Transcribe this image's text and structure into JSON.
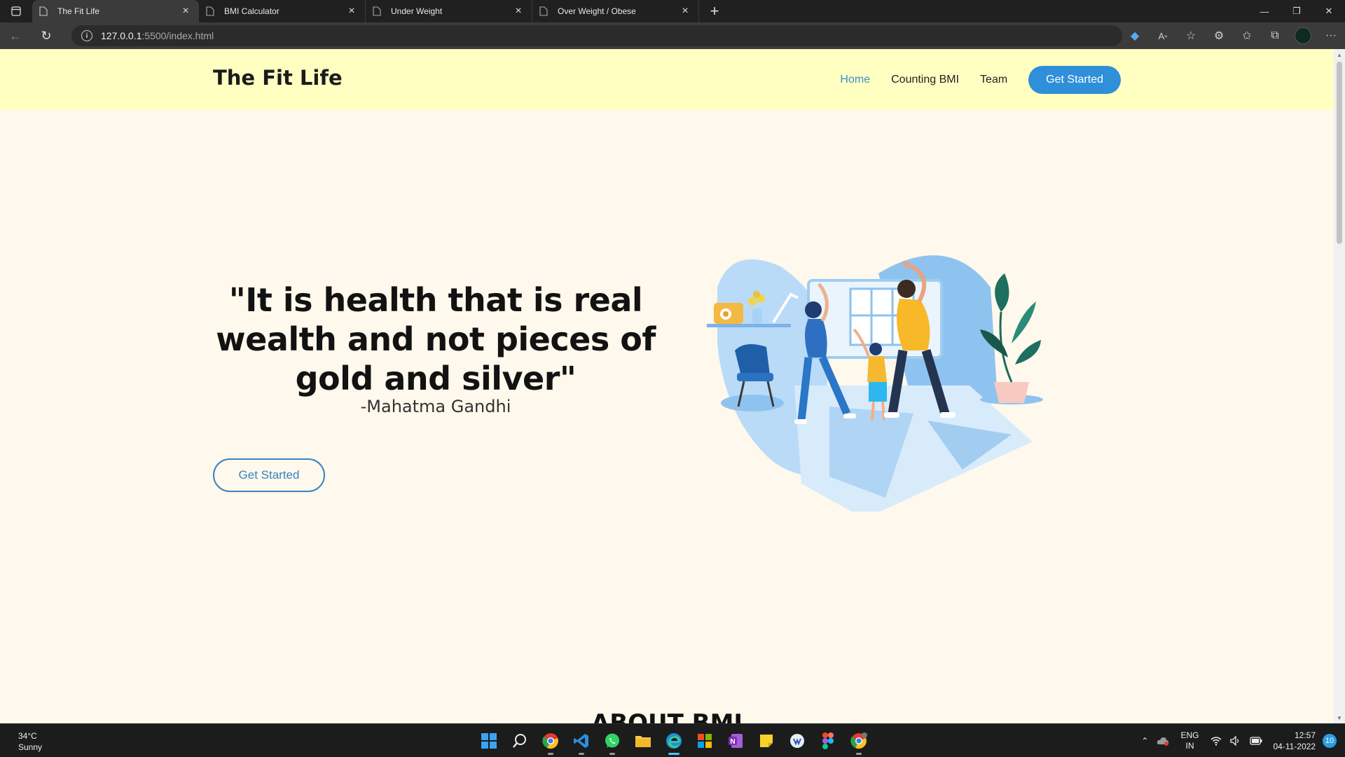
{
  "browser": {
    "tabs": [
      {
        "title": "The Fit Life",
        "active": true
      },
      {
        "title": "BMI Calculator",
        "active": false
      },
      {
        "title": "Under Weight",
        "active": false
      },
      {
        "title": "Over Weight / Obese",
        "active": false
      }
    ],
    "url_host": "127.0.0.1",
    "url_path": ":5500/index.html"
  },
  "site": {
    "brand": "The Fit Life",
    "nav": {
      "home": "Home",
      "counting_bmi": "Counting BMI",
      "team": "Team",
      "get_started": "Get Started"
    },
    "hero": {
      "quote": "\"It is health that is real wealth and not pieces of gold and silver\"",
      "author": "-Mahatma Gandhi",
      "button": "Get Started"
    },
    "next_section_heading": "ABOUT BMI"
  },
  "colors": {
    "header_bg": "#ffffc2",
    "page_bg": "#fff8ec",
    "accent": "#2f8fd8"
  },
  "taskbar": {
    "weather_temp": "34°C",
    "weather_desc": "Sunny",
    "lang_line1": "ENG",
    "lang_line2": "IN",
    "time": "12:57",
    "date": "04-11-2022",
    "notification_count": "10",
    "apps": [
      "start-icon",
      "search-icon",
      "chrome-icon",
      "vscode-icon",
      "whatsapp-icon",
      "file-explorer-icon",
      "edge-icon",
      "store-icon",
      "onenote-icon",
      "sticky-notes-icon",
      "app-circle-icon",
      "figma-icon",
      "chrome-icon"
    ]
  }
}
